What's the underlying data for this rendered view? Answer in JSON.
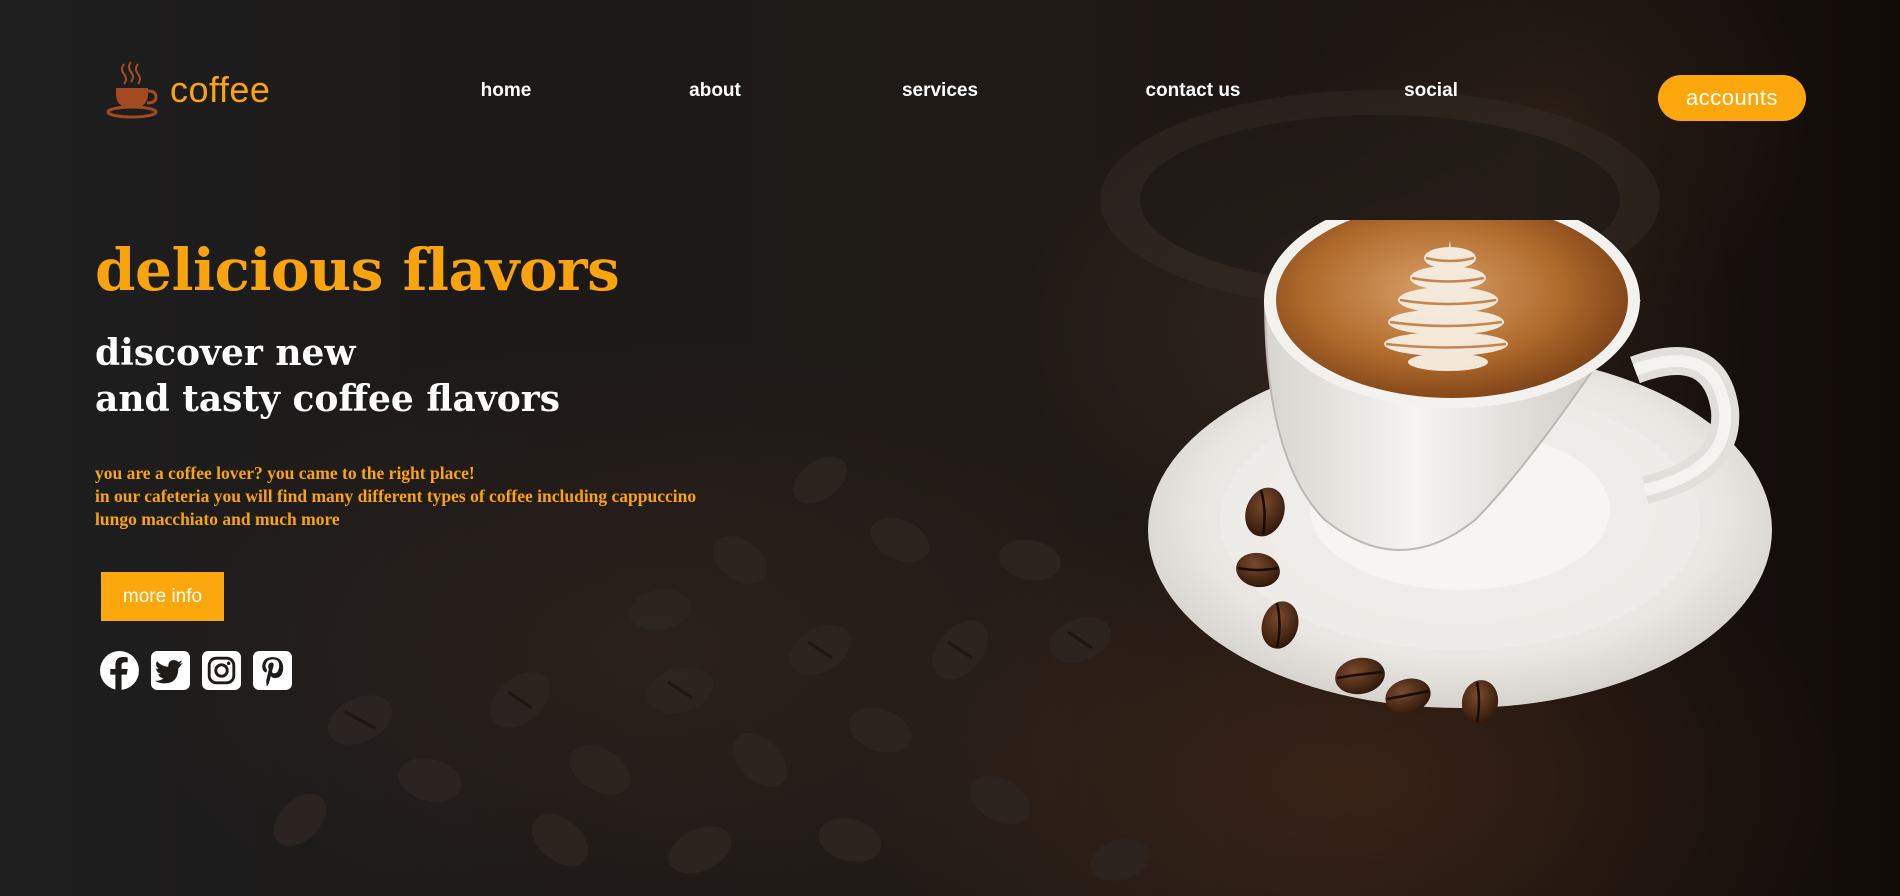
{
  "brand": {
    "name": "coffee",
    "icon": "coffee-cup-icon"
  },
  "nav": {
    "items": [
      {
        "label": "home"
      },
      {
        "label": "about"
      },
      {
        "label": "services"
      },
      {
        "label": "contact us"
      },
      {
        "label": "social"
      }
    ],
    "accounts_label": "accounts"
  },
  "hero": {
    "title": "delicious flavors",
    "subtitle_line1": "discover new",
    "subtitle_line2": "and tasty coffee flavors",
    "desc_line1": "you are a coffee lover? you came to the right place!",
    "desc_line2": "in our cafeteria you will find many different types of coffee including cappuccino",
    "desc_line3": "lungo macchiato and much more",
    "button_label": "more info"
  },
  "social": {
    "icons": [
      "facebook-icon",
      "twitter-icon",
      "instagram-icon",
      "pinterest-icon"
    ]
  },
  "colors": {
    "accent": "#fca80c",
    "text_light": "#ffffff",
    "background": "#1b1613"
  }
}
